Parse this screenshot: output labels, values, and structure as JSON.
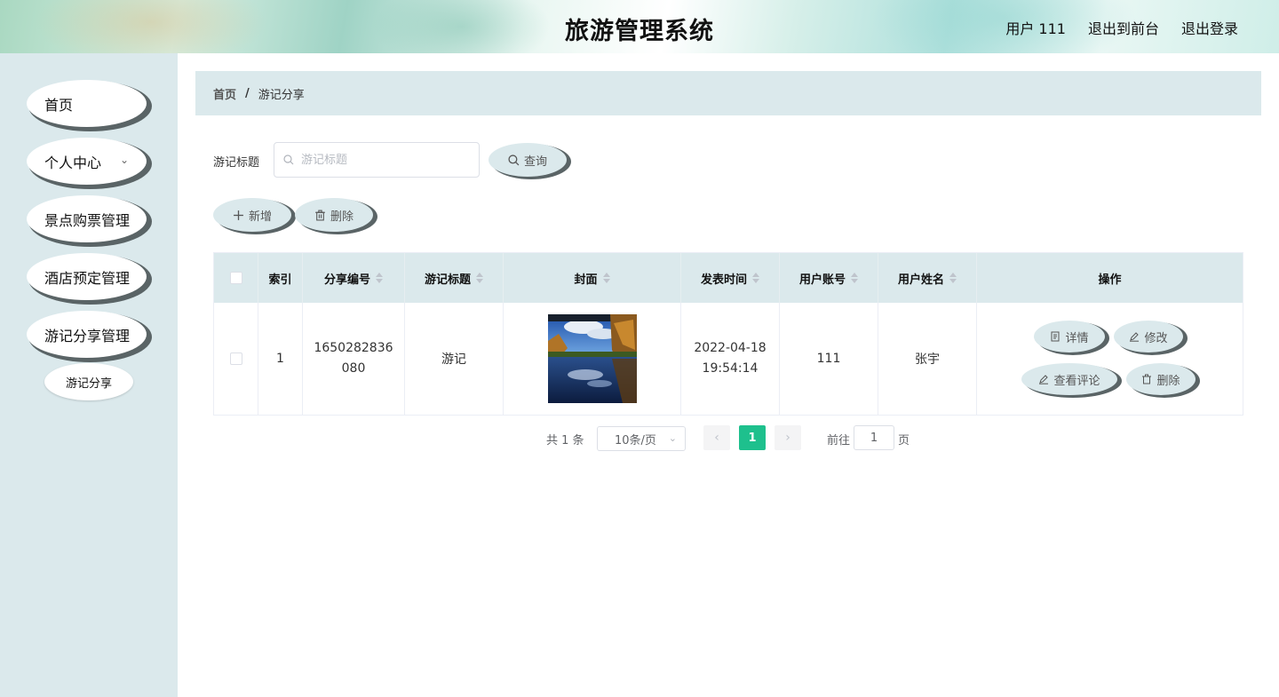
{
  "header": {
    "title": "旅游管理系统",
    "user_label": "用户 111",
    "to_front_label": "退出到前台",
    "logout_label": "退出登录"
  },
  "sidebar": {
    "items": [
      {
        "label": "首页"
      },
      {
        "label": "个人中心",
        "icon": "chevron-down-icon"
      },
      {
        "label": "景点购票管理"
      },
      {
        "label": "酒店预定管理"
      },
      {
        "label": "游记分享管理"
      }
    ],
    "sub_items": [
      {
        "label": "游记分享"
      }
    ]
  },
  "breadcrumb": {
    "home": "首页",
    "separator": "/",
    "current": "游记分享"
  },
  "search": {
    "label": "游记标题",
    "placeholder": "游记标题",
    "value": "",
    "button_label": "查询",
    "button_icon": "search-icon"
  },
  "toolbar": {
    "add_label": "新增",
    "add_icon": "plus-icon",
    "delete_label": "删除",
    "delete_icon": "trash-icon"
  },
  "table": {
    "columns": [
      "索引",
      "分享编号",
      "游记标题",
      "封面",
      "发表时间",
      "用户账号",
      "用户姓名",
      "操作"
    ],
    "sortable": [
      false,
      true,
      true,
      true,
      true,
      true,
      true,
      false
    ],
    "rows": [
      {
        "index": "1",
        "code": "1650282836080",
        "title": "游记",
        "cover_image": "autumn lake landscape",
        "time": "2022-04-18 19:54:14",
        "account": "111",
        "name": "张宇",
        "actions": {
          "detail": "详情",
          "edit": "修改",
          "comments": "查看评论",
          "delete": "删除"
        }
      }
    ]
  },
  "pagination": {
    "total": "共 1 条",
    "page_size": "10条/页",
    "current_page": "1",
    "goto_label": "前往",
    "goto_value": "1",
    "page_suffix": "页"
  },
  "colors": {
    "accent": "#1ec08d",
    "panel": "#dbe9ec",
    "shadow": "#5a6466"
  }
}
